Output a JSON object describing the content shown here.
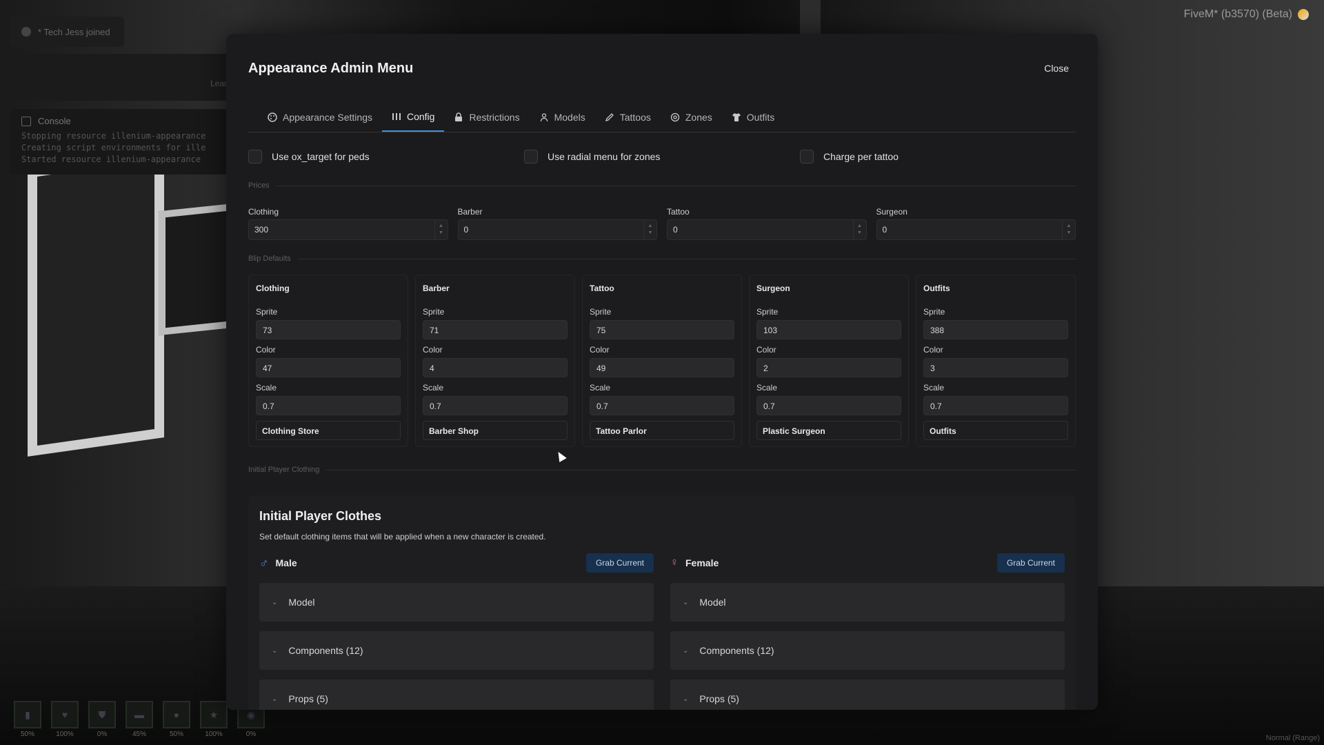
{
  "topbar": {
    "fivem_label": "FiveM* (b3570) (Beta)"
  },
  "chat": {
    "message": "* Tech Jess joined"
  },
  "side_panel": {
    "learn_text": "Lear"
  },
  "console": {
    "title": "Console",
    "lines": [
      "Stopping resource illenium-appearance",
      "Creating script environments for ille",
      "Started resource illenium-appearance"
    ]
  },
  "hud": {
    "items": [
      "50%",
      "100%",
      "0%",
      "45%",
      "50%",
      "100%",
      "0%"
    ]
  },
  "bottom_right": "Normal (Range)",
  "modal": {
    "title": "Appearance Admin Menu",
    "close_label": "Close",
    "tabs": [
      {
        "label": "Appearance Settings",
        "icon": "palette-icon"
      },
      {
        "label": "Config",
        "icon": "config-icon"
      },
      {
        "label": "Restrictions",
        "icon": "lock-icon"
      },
      {
        "label": "Models",
        "icon": "user-icon"
      },
      {
        "label": "Tattoos",
        "icon": "pen-icon"
      },
      {
        "label": "Zones",
        "icon": "target-icon"
      },
      {
        "label": "Outfits",
        "icon": "shirt-icon"
      }
    ],
    "active_tab": "Config",
    "checks": [
      {
        "label": "Use ox_target for peds",
        "checked": false
      },
      {
        "label": "Use radial menu for zones",
        "checked": false
      },
      {
        "label": "Charge per tattoo",
        "checked": false
      }
    ],
    "prices_section": "Prices",
    "prices": [
      {
        "label": "Clothing",
        "value": "300"
      },
      {
        "label": "Barber",
        "value": "0"
      },
      {
        "label": "Tattoo",
        "value": "0"
      },
      {
        "label": "Surgeon",
        "value": "0"
      }
    ],
    "blips_section": "Blip Defaults",
    "blips": [
      {
        "title": "Clothing",
        "sprite": "73",
        "color": "47",
        "scale": "0.7",
        "name": "Clothing Store"
      },
      {
        "title": "Barber",
        "sprite": "71",
        "color": "4",
        "scale": "0.7",
        "name": "Barber Shop"
      },
      {
        "title": "Tattoo",
        "sprite": "75",
        "color": "49",
        "scale": "0.7",
        "name": "Tattoo Parlor"
      },
      {
        "title": "Surgeon",
        "sprite": "103",
        "color": "2",
        "scale": "0.7",
        "name": "Plastic Surgeon"
      },
      {
        "title": "Outfits",
        "sprite": "388",
        "color": "3",
        "scale": "0.7",
        "name": "Outfits"
      }
    ],
    "field_labels": {
      "sprite": "Sprite",
      "color": "Color",
      "scale": "Scale"
    },
    "initial_section": "Initial Player Clothing",
    "initial": {
      "title": "Initial Player Clothes",
      "description": "Set default clothing items that will be applied when a new character is created.",
      "grab_label": "Grab Current",
      "male_label": "Male",
      "female_label": "Female",
      "items": [
        "Model",
        "Components (12)",
        "Props (5)"
      ]
    }
  }
}
